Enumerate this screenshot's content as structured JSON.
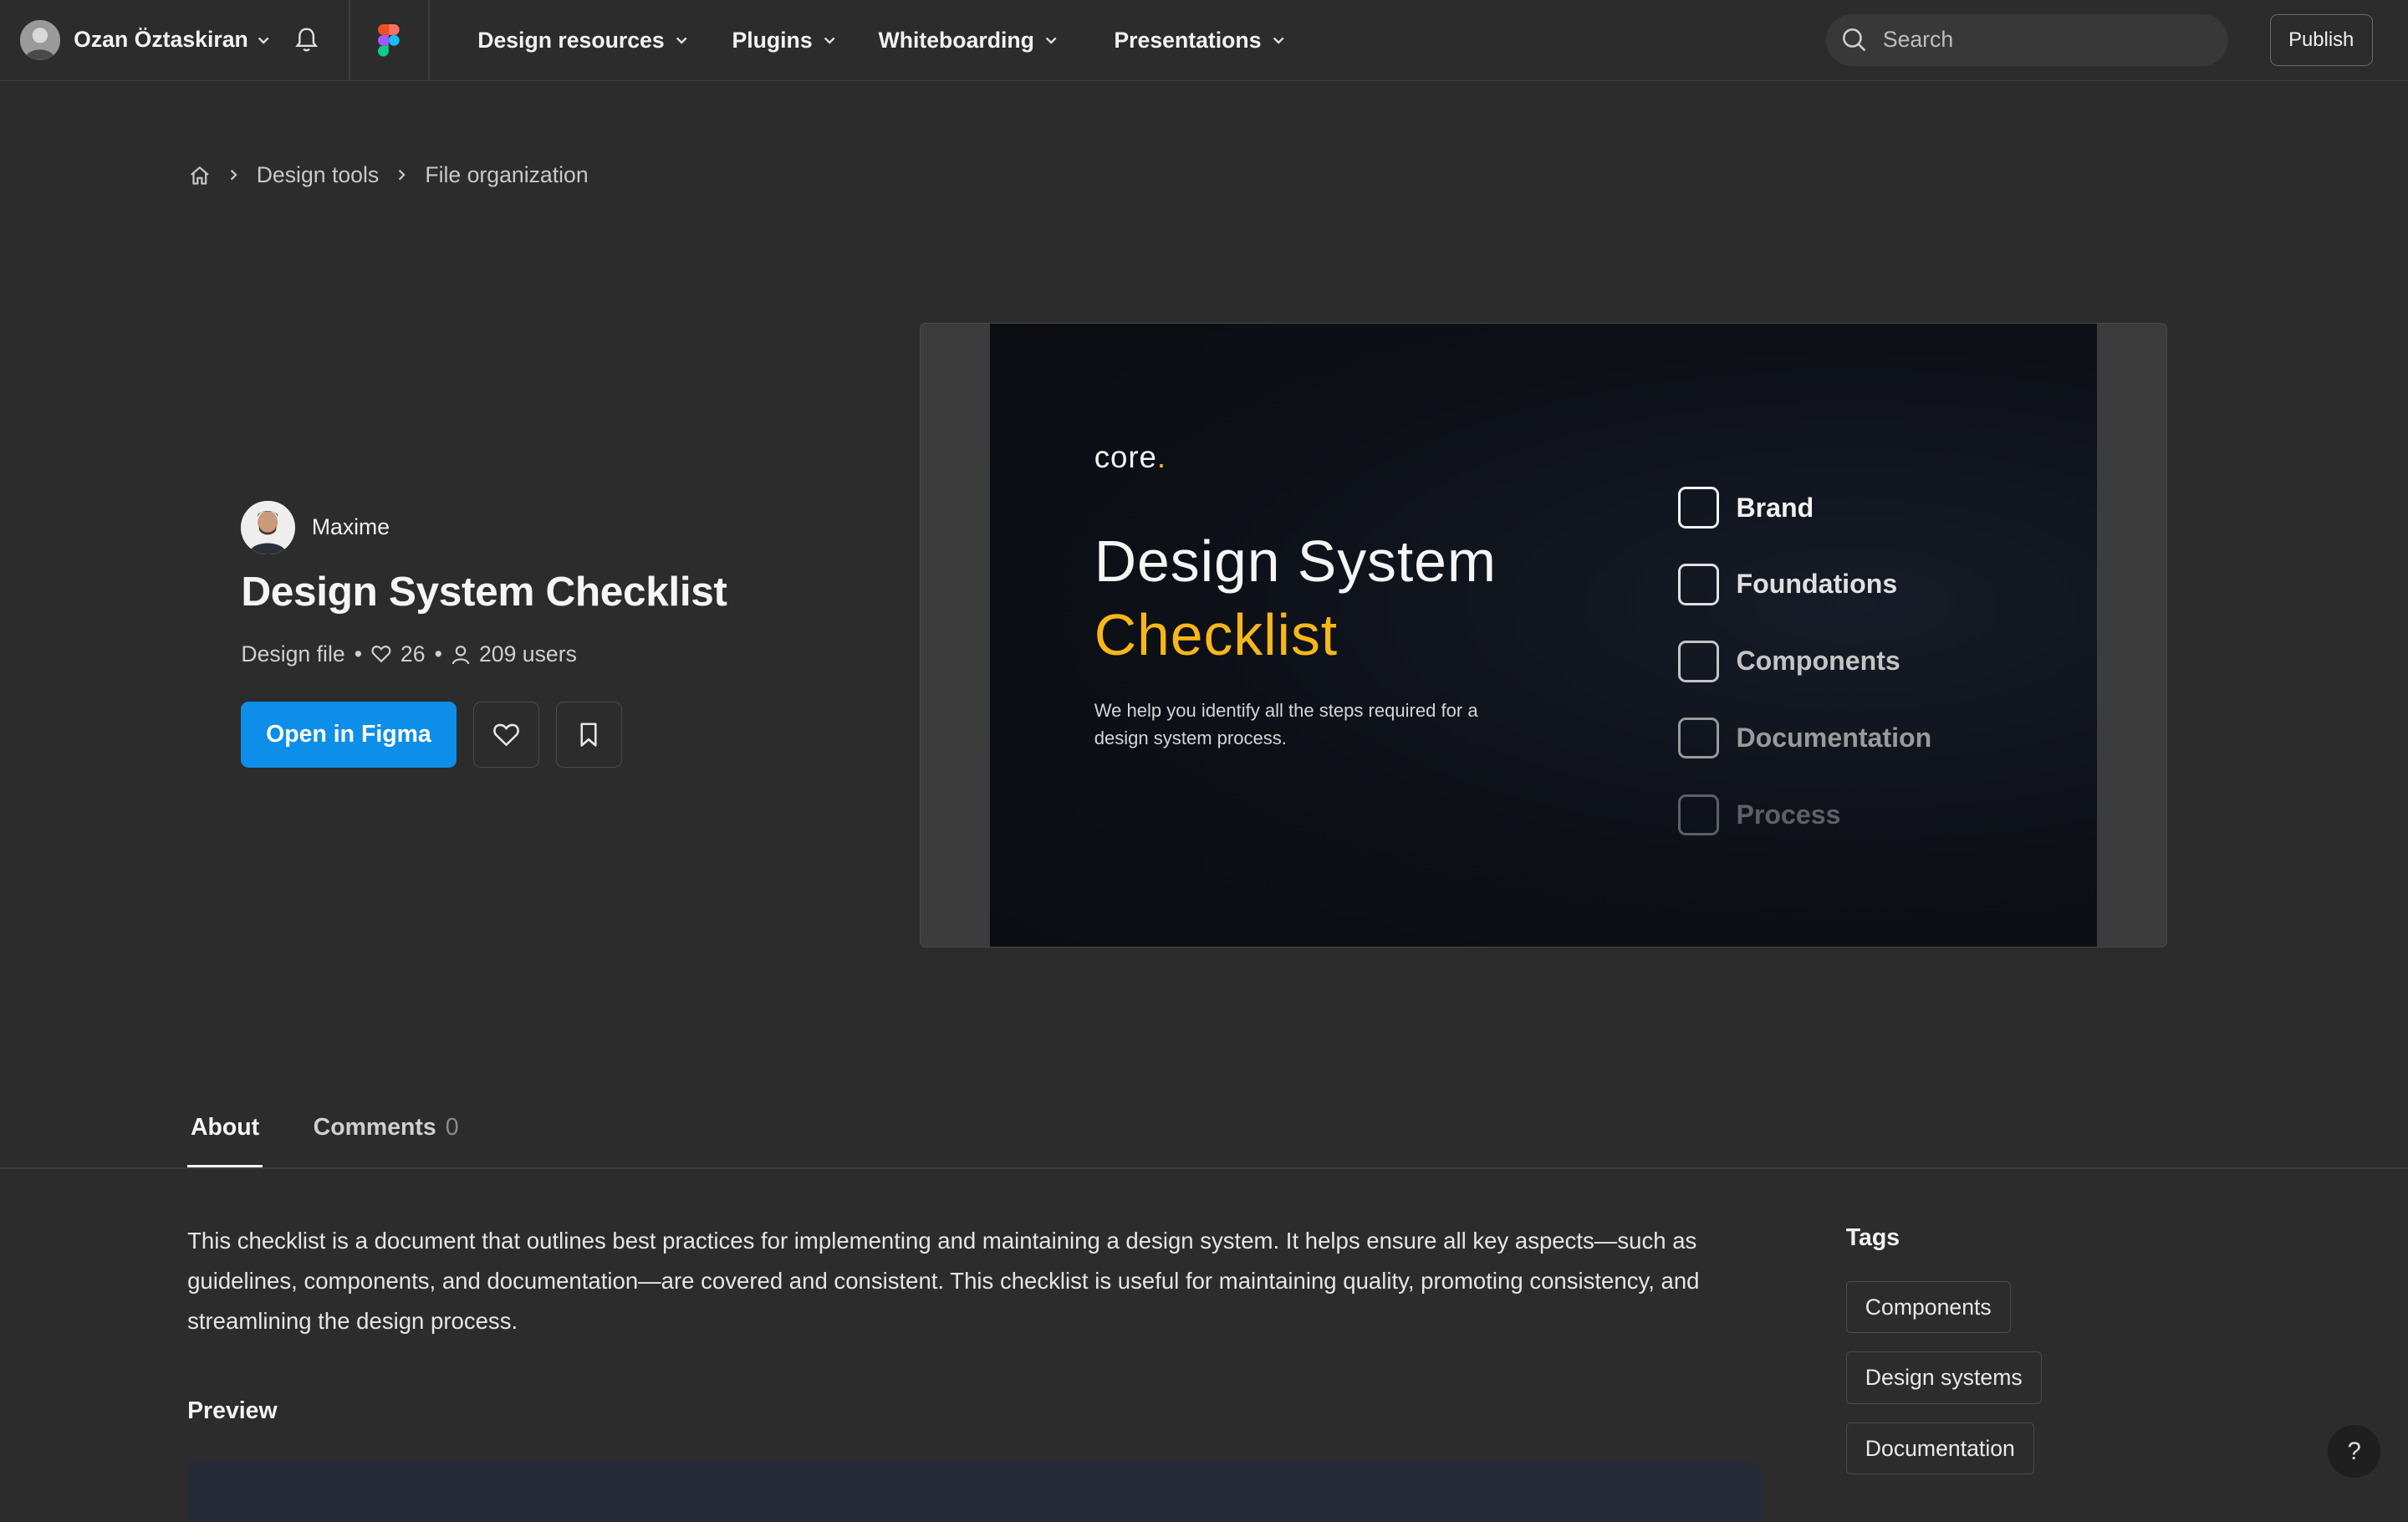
{
  "topbar": {
    "user_name": "Ozan Öztaskiran",
    "nav": [
      {
        "label": "Design resources"
      },
      {
        "label": "Plugins"
      },
      {
        "label": "Whiteboarding"
      },
      {
        "label": "Presentations"
      }
    ],
    "search_placeholder": "Search",
    "publish_label": "Publish"
  },
  "breadcrumb": {
    "items": [
      "Design tools",
      "File organization"
    ]
  },
  "resource": {
    "author": "Maxime",
    "title": "Design System Checklist",
    "type": "Design file",
    "likes": "26",
    "users": "209 users",
    "open_label": "Open in Figma"
  },
  "slide": {
    "logo": "core",
    "logo_dot": ".",
    "title_line1": "Design System",
    "title_line2": "Checklist",
    "subtitle": "We help you identify all the steps required for a design system process.",
    "checklist": [
      {
        "label": "Brand",
        "color": "#f2f2f2"
      },
      {
        "label": "Foundations",
        "color": "#e0e0e0"
      },
      {
        "label": "Components",
        "color": "#c4c4c4"
      },
      {
        "label": "Documentation",
        "color": "#9a9a9a"
      },
      {
        "label": "Process",
        "color": "#5f6066"
      }
    ],
    "accent_color": "#f7b719"
  },
  "tabs": {
    "about": "About",
    "comments": "Comments",
    "comments_count": "0"
  },
  "about": {
    "description": "This checklist is a document that outlines best practices for implementing and maintaining a design system. It helps ensure all key aspects—such as guidelines, components, and documentation—are covered and consistent. This checklist is useful for maintaining quality, promoting consistency, and streamlining the design process.",
    "preview_heading": "Preview"
  },
  "tags": {
    "heading": "Tags",
    "items": [
      "Components",
      "Design systems",
      "Documentation"
    ]
  },
  "help_label": "?",
  "colors": {
    "background": "#2c2c2c",
    "primary_button": "#0d8ee8"
  }
}
